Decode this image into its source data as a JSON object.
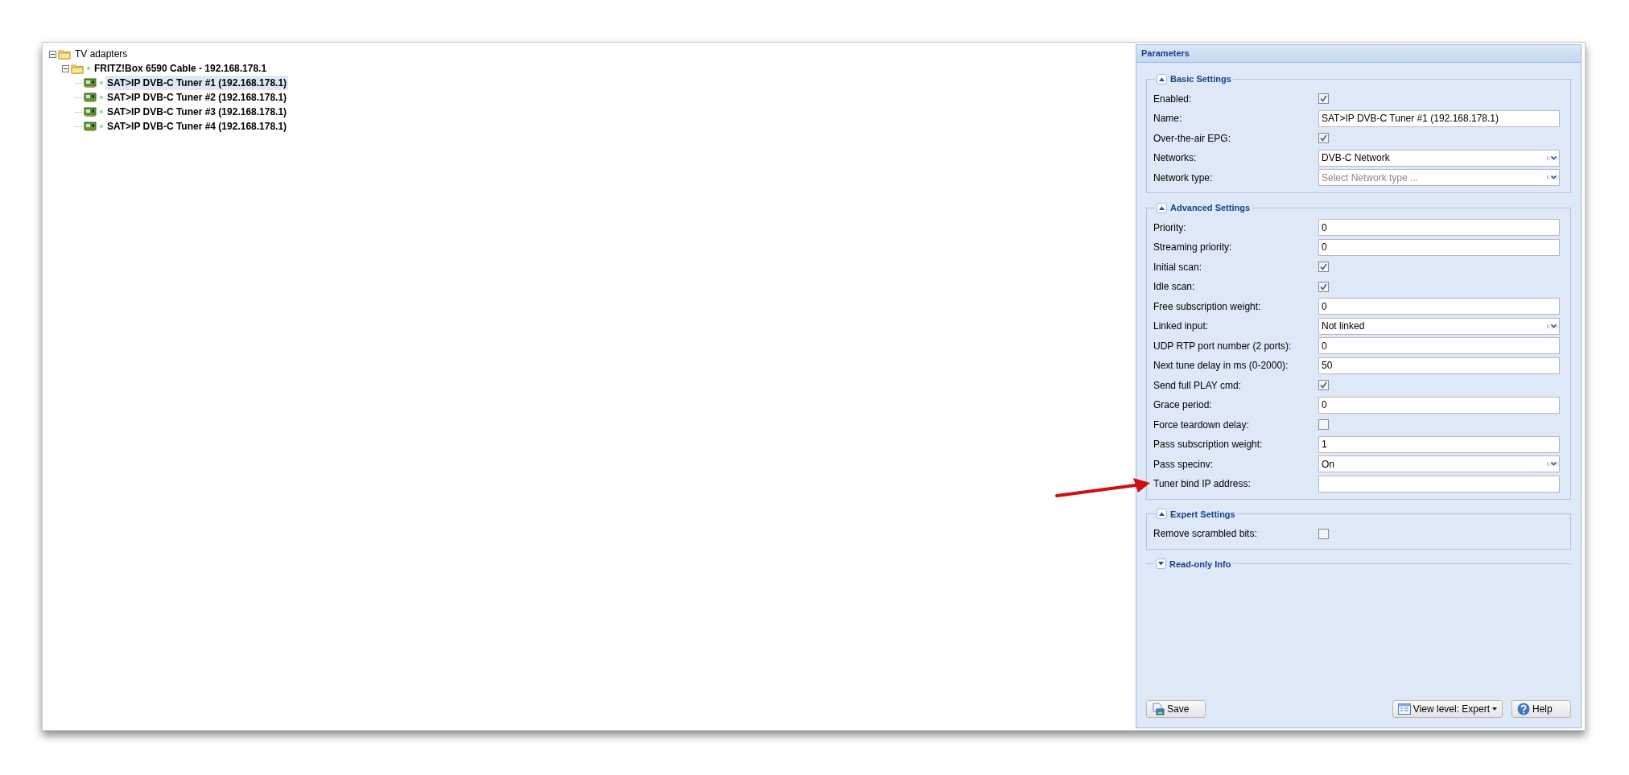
{
  "tree": [
    {
      "label": "TV adapters",
      "kind": "folder",
      "selected": false,
      "expanded": true,
      "children": [
        {
          "label": "FRITZ!Box 6590 Cable - 192.168.178.1",
          "kind": "device",
          "selected": false,
          "expanded": true,
          "children": [
            {
              "label": "SAT>IP DVB-C Tuner #1 (192.168.178.1)",
              "kind": "tuner",
              "selected": true
            },
            {
              "label": "SAT>IP DVB-C Tuner #2 (192.168.178.1)",
              "kind": "tuner",
              "selected": false
            },
            {
              "label": "SAT>IP DVB-C Tuner #3 (192.168.178.1)",
              "kind": "tuner",
              "selected": false
            },
            {
              "label": "SAT>IP DVB-C Tuner #4 (192.168.178.1)",
              "kind": "tuner",
              "selected": false
            }
          ]
        }
      ]
    }
  ],
  "panel": {
    "title": "Parameters",
    "sections": [
      {
        "title": "Basic Settings",
        "expanded": true,
        "fields": [
          {
            "label": "Enabled:",
            "kind": "checkbox",
            "checked": true
          },
          {
            "label": "Name:",
            "kind": "text",
            "value": "SAT>IP DVB-C Tuner #1 (192.168.178.1)"
          },
          {
            "label": "Over-the-air EPG:",
            "kind": "checkbox",
            "checked": true
          },
          {
            "label": "Networks:",
            "kind": "combo",
            "value": "DVB-C Network"
          },
          {
            "label": "Network type:",
            "kind": "combo",
            "placeholder": "Select Network type ..."
          }
        ]
      },
      {
        "title": "Advanced Settings",
        "expanded": true,
        "fields": [
          {
            "label": "Priority:",
            "kind": "text",
            "value": "0"
          },
          {
            "label": "Streaming priority:",
            "kind": "text",
            "value": "0"
          },
          {
            "label": "Initial scan:",
            "kind": "checkbox",
            "checked": true
          },
          {
            "label": "Idle scan:",
            "kind": "checkbox",
            "checked": true
          },
          {
            "label": "Free subscription weight:",
            "kind": "text",
            "value": "0"
          },
          {
            "label": "Linked input:",
            "kind": "combo",
            "value": "Not linked"
          },
          {
            "label": "UDP RTP port number (2 ports):",
            "kind": "text",
            "value": "0"
          },
          {
            "label": "Next tune delay in ms (0-2000):",
            "kind": "text",
            "value": "50"
          },
          {
            "label": "Send full PLAY cmd:",
            "kind": "checkbox",
            "checked": true
          },
          {
            "label": "Grace period:",
            "kind": "text",
            "value": "0"
          },
          {
            "label": "Force teardown delay:",
            "kind": "checkbox",
            "checked": false
          },
          {
            "label": "Pass subscription weight:",
            "kind": "text",
            "value": "1"
          },
          {
            "label": "Pass specinv:",
            "kind": "combo",
            "value": "On"
          },
          {
            "label": "Tuner bind IP address:",
            "kind": "text"
          }
        ]
      },
      {
        "title": "Expert Settings",
        "expanded": true,
        "fields": [
          {
            "label": "Remove scrambled bits:",
            "kind": "checkbox",
            "checked": false
          }
        ]
      },
      {
        "title": "Read-only Info",
        "expanded": false
      }
    ],
    "buttons": [
      {
        "label": "Save",
        "kind": "save"
      },
      {
        "label": "View level: Expert",
        "kind": "menu"
      },
      {
        "label": "Help",
        "kind": "help"
      }
    ]
  }
}
